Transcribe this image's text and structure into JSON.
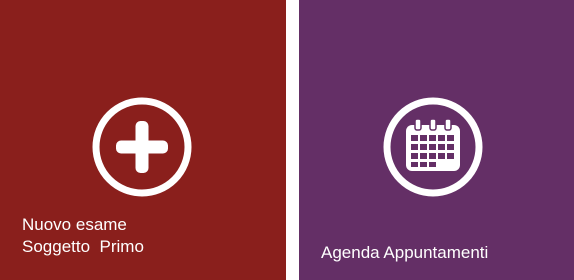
{
  "tiles": {
    "new_exam": {
      "line1": "Nuovo esame",
      "line2": "Soggetto  Primo",
      "color": "#8a1f1c",
      "icon": "plus-circle-icon"
    },
    "agenda": {
      "label": "Agenda Appuntamenti",
      "color": "#642f66",
      "icon": "calendar-circle-icon"
    }
  }
}
